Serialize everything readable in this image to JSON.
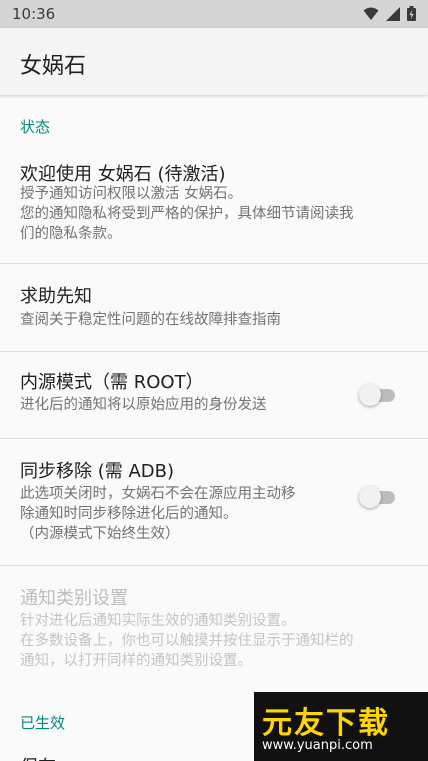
{
  "status_bar": {
    "time": "10:36",
    "icons": [
      "wifi-icon",
      "signal-icon",
      "battery-icon"
    ]
  },
  "app_bar": {
    "title": "女娲石"
  },
  "sections": {
    "status_header": "状态",
    "active_header": "已生效",
    "partial_next_item": "保存"
  },
  "prefs": {
    "welcome": {
      "title": "欢迎使用 女娲石 (待激活)",
      "summary_line1": "授予通知访问权限以激活 女娲石。",
      "summary_line2": "您的通知隐私将受到严格的保护，具体细节请阅读我",
      "summary_line3": "们的隐私条款。"
    },
    "help": {
      "title": "求助先知",
      "summary": "查阅关于稳定性问题的在线故障排查指南"
    },
    "inner_mode": {
      "title": "内源模式（需 ROOT）",
      "summary": "进化后的通知将以原始应用的身份发送",
      "enabled": false
    },
    "sync_remove": {
      "title": "同步移除 (需 ADB)",
      "summary_line1": "此选项关闭时，女娲石不会在源应用主动移",
      "summary_line2": "除通知时同步移除进化后的通知。",
      "summary_line3": "（内源模式下始终生效）",
      "enabled": false
    },
    "channel_settings": {
      "title": "通知类别设置",
      "summary_line1": "针对进化后通知实际生效的通知类别设置。",
      "summary_line2": "在多数设备上，你也可以触摸并按住显示于通知栏的",
      "summary_line3": "通知，以打开同样的通知类别设置。"
    }
  },
  "watermark": {
    "main": "元友下载",
    "url": "www.yuanpi.com"
  },
  "colors": {
    "accent": "#00897b",
    "status_bar": "#d5d5d5",
    "app_bar": "#f5f5f5",
    "background": "#fafafa",
    "switch_off_track": "#bdbdbd"
  }
}
